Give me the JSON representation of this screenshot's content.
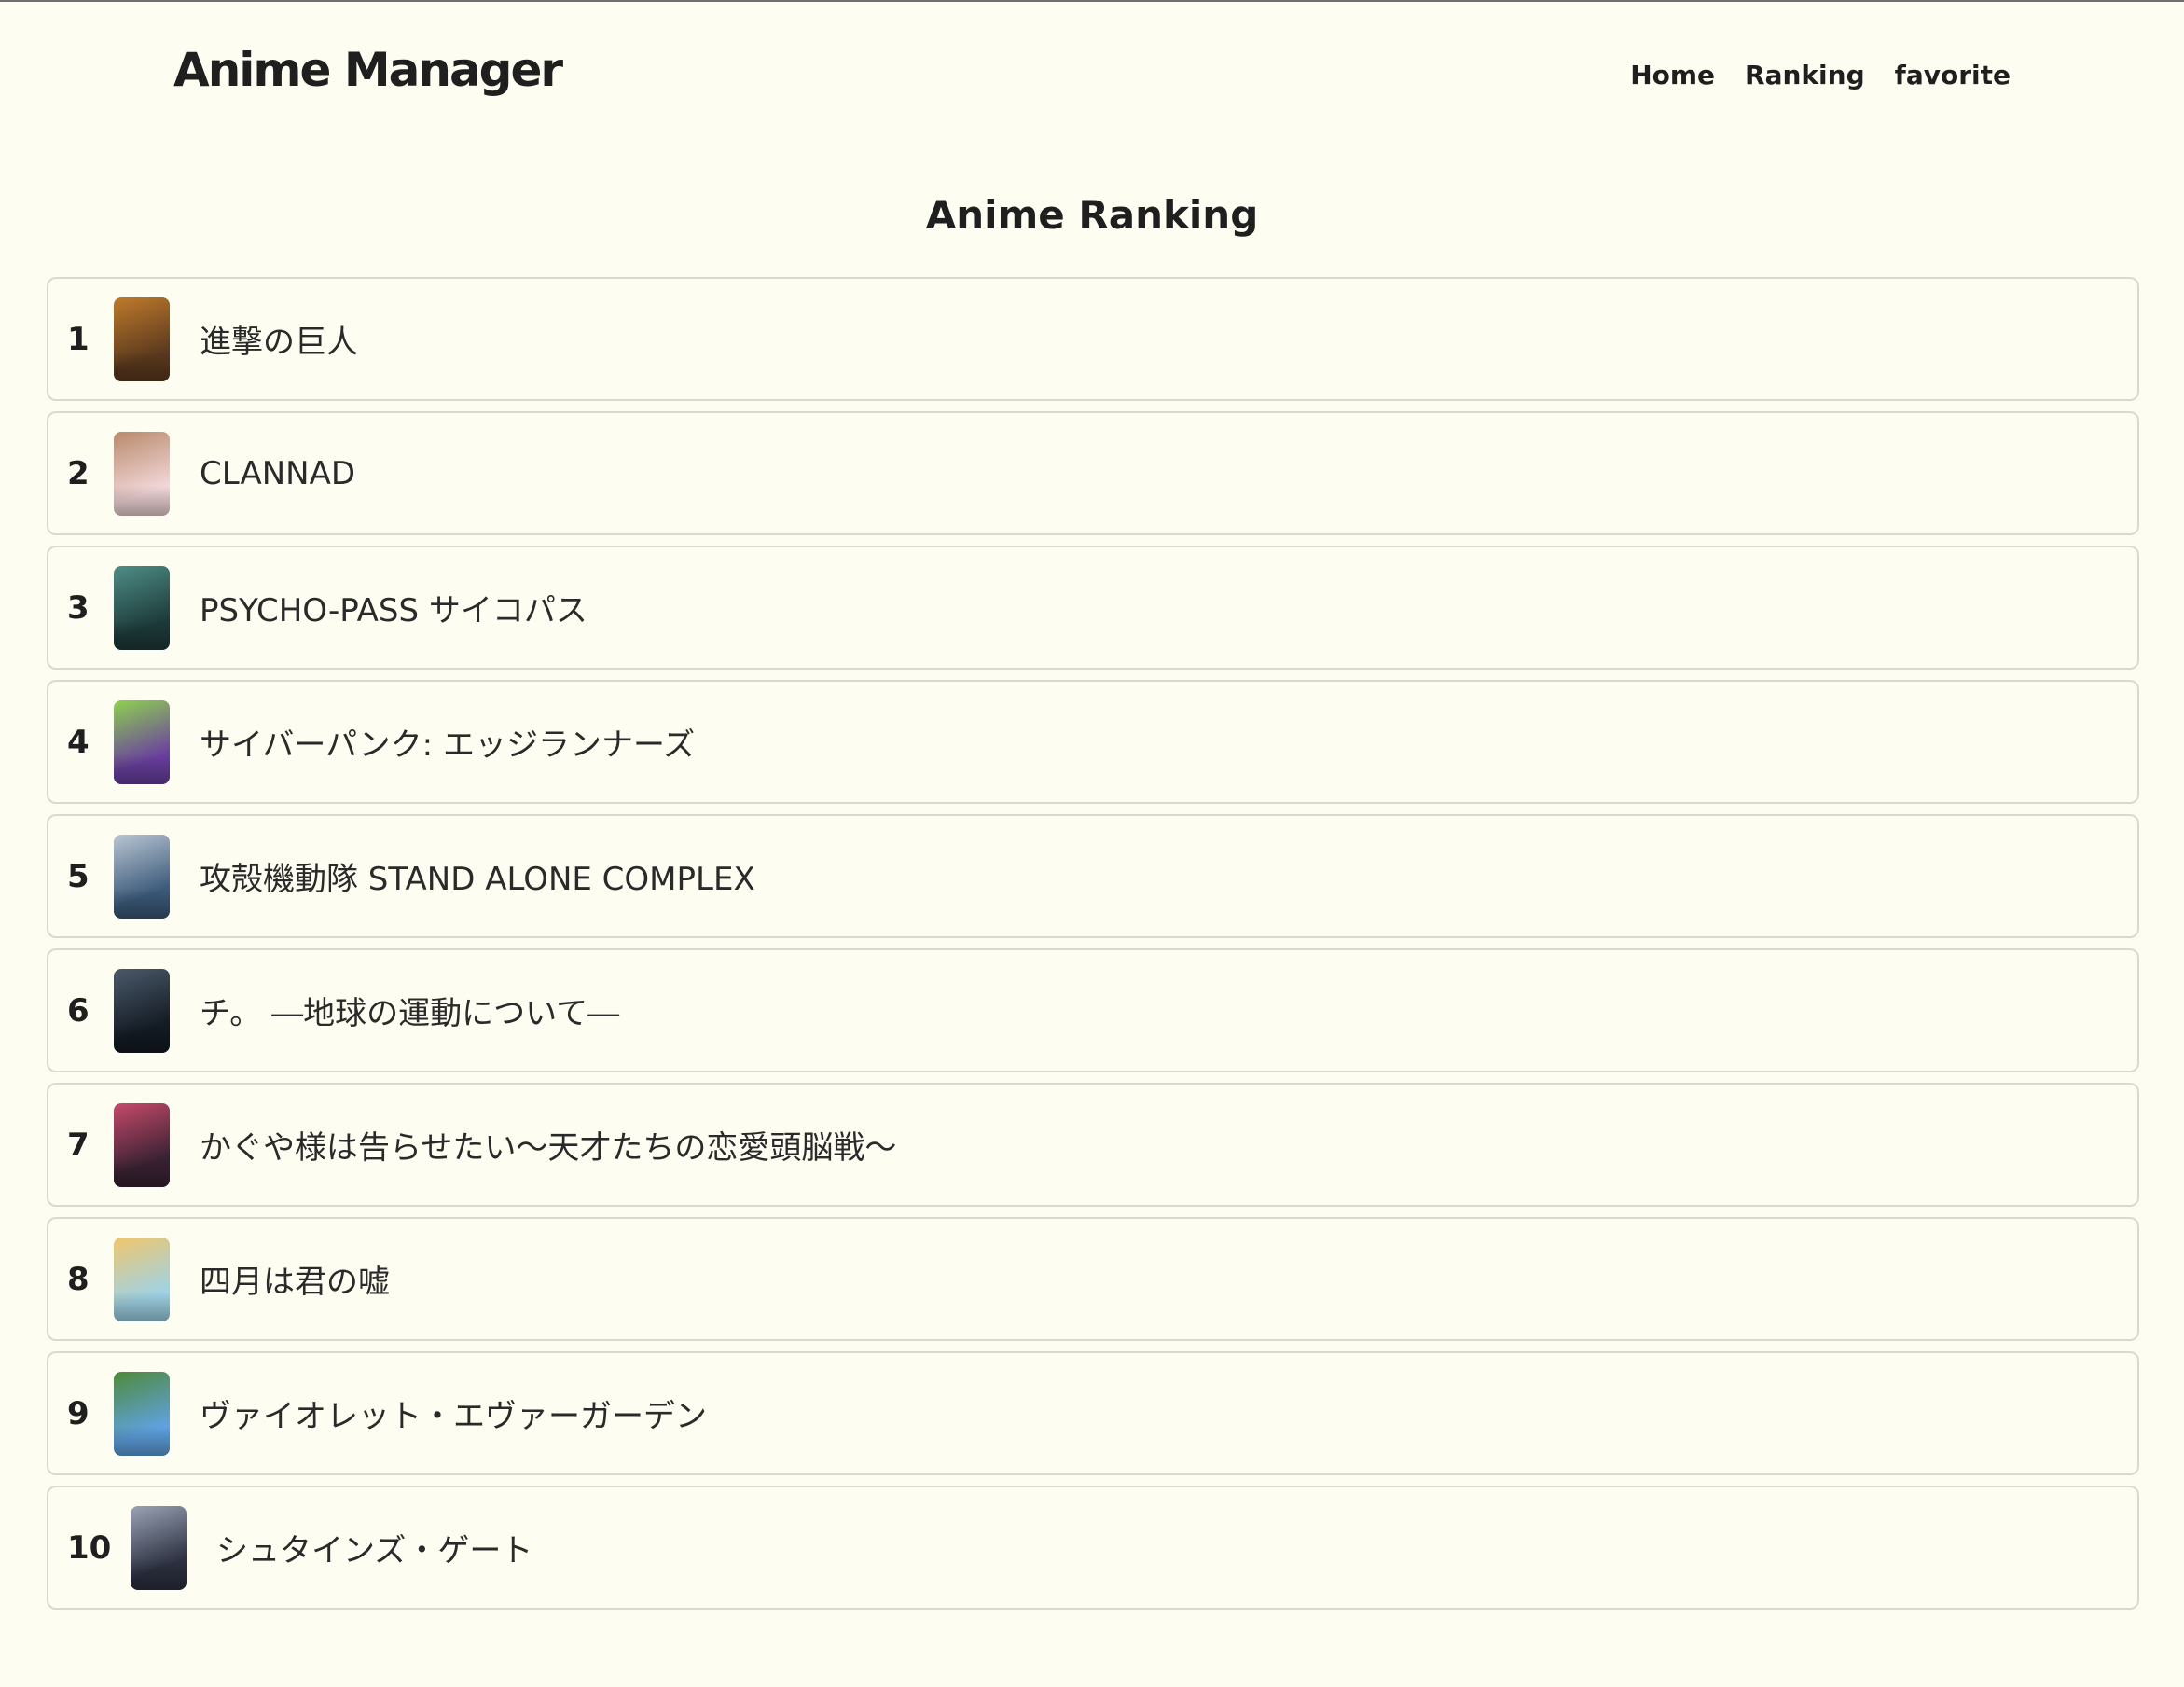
{
  "header": {
    "brand": "Anime Manager",
    "nav": [
      "Home",
      "Ranking",
      "favorite"
    ]
  },
  "page": {
    "title": "Anime Ranking"
  },
  "ranking": [
    {
      "rank": "1",
      "title": "進撃の巨人",
      "poster_colors": [
        "#5b3a1e",
        "#c07a2c"
      ]
    },
    {
      "rank": "2",
      "title": "CLANNAD",
      "poster_colors": [
        "#f2d6d8",
        "#b88a6a"
      ]
    },
    {
      "rank": "3",
      "title": "PSYCHO-PASS サイコパス",
      "poster_colors": [
        "#1d3b3a",
        "#4f8d86"
      ]
    },
    {
      "rank": "4",
      "title": "サイバーパンク: エッジランナーズ",
      "poster_colors": [
        "#6a3fa0",
        "#8fd14f"
      ]
    },
    {
      "rank": "5",
      "title": "攻殻機動隊 STAND ALONE COMPLEX",
      "poster_colors": [
        "#3c5a7a",
        "#b9c6d3"
      ]
    },
    {
      "rank": "6",
      "title": "チ。 ―地球の運動について―",
      "poster_colors": [
        "#141b24",
        "#4a5a6b"
      ]
    },
    {
      "rank": "7",
      "title": "かぐや様は告らせたい～天才たちの恋愛頭脳戦～",
      "poster_colors": [
        "#3a2233",
        "#c64a6a"
      ]
    },
    {
      "rank": "8",
      "title": "四月は君の嘘",
      "poster_colors": [
        "#9fd3e6",
        "#f0c66b"
      ]
    },
    {
      "rank": "9",
      "title": "ヴァイオレット・エヴァーガーデン",
      "poster_colors": [
        "#5fa2e0",
        "#4f8a3a"
      ]
    },
    {
      "rank": "10",
      "title": "シュタインズ・ゲート",
      "poster_colors": [
        "#2c3040",
        "#9aa3b5"
      ]
    }
  ]
}
